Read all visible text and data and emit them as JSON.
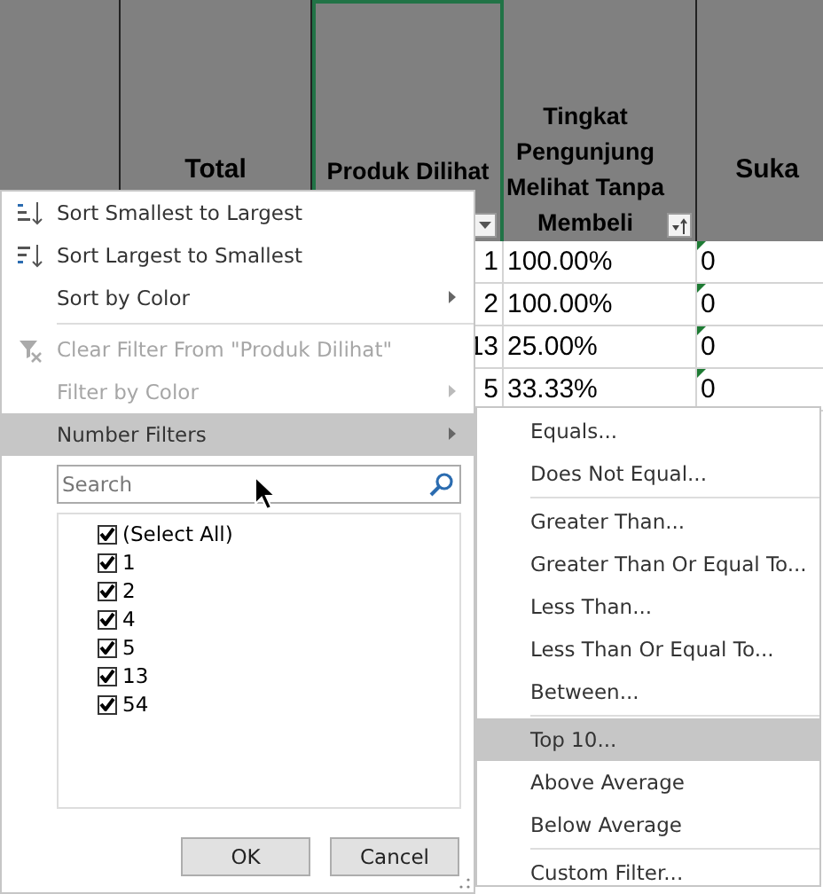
{
  "sheet": {
    "columns": [
      {
        "header": "Total",
        "selected": false,
        "kind": "plain"
      },
      {
        "header": "Produk Dilihat",
        "selected": true,
        "kind": "filter"
      },
      {
        "header": "Tingkat Pengunjung Melihat Tanpa Membeli",
        "selected": false,
        "kind": "sorted"
      },
      {
        "header": "Suka",
        "selected": false,
        "kind": "plain"
      }
    ],
    "rows": [
      {
        "cells": [
          "",
          "1",
          "100.00%",
          "0"
        ],
        "flagged": true
      },
      {
        "cells": [
          "",
          "2",
          "100.00%",
          "0"
        ],
        "flagged": true
      },
      {
        "cells": [
          "",
          "13",
          "25.00%",
          "0"
        ],
        "flagged": true
      },
      {
        "cells": [
          "",
          "5",
          "33.33%",
          "0"
        ],
        "flagged": true
      }
    ]
  },
  "filter_menu": {
    "items": [
      {
        "kind": "command",
        "label": "Sort Smallest to Largest",
        "disabled": false,
        "submenu": false,
        "selected": false
      },
      {
        "kind": "command",
        "label": "Sort Largest to Smallest",
        "disabled": false,
        "submenu": false,
        "selected": false
      },
      {
        "kind": "command",
        "label": "Sort by Color",
        "disabled": false,
        "submenu": true,
        "selected": false
      },
      {
        "kind": "separator"
      },
      {
        "kind": "command",
        "label": "Clear Filter From \"Produk Dilihat\"",
        "disabled": true,
        "submenu": false,
        "selected": false
      },
      {
        "kind": "command",
        "label": "Filter by Color",
        "disabled": true,
        "submenu": true,
        "selected": false
      },
      {
        "kind": "command",
        "label": "Number Filters",
        "disabled": false,
        "submenu": true,
        "selected": true
      }
    ],
    "search": {
      "placeholder": "Search"
    },
    "values": [
      {
        "label": "(Select All)",
        "checked": true
      },
      {
        "label": "1",
        "checked": true
      },
      {
        "label": "2",
        "checked": true
      },
      {
        "label": "4",
        "checked": true
      },
      {
        "label": "5",
        "checked": true
      },
      {
        "label": "13",
        "checked": true
      },
      {
        "label": "54",
        "checked": true
      }
    ],
    "buttons": [
      "OK",
      "Cancel"
    ]
  },
  "number_filters_menu": {
    "items": [
      {
        "kind": "command",
        "label": "Equals...",
        "selected": false
      },
      {
        "kind": "command",
        "label": "Does Not Equal...",
        "selected": false
      },
      {
        "kind": "separator"
      },
      {
        "kind": "command",
        "label": "Greater Than...",
        "selected": false
      },
      {
        "kind": "command",
        "label": "Greater Than Or Equal To...",
        "selected": false
      },
      {
        "kind": "command",
        "label": "Less Than...",
        "selected": false
      },
      {
        "kind": "command",
        "label": "Less Than Or Equal To...",
        "selected": false
      },
      {
        "kind": "command",
        "label": "Between...",
        "selected": false
      },
      {
        "kind": "separator"
      },
      {
        "kind": "command",
        "label": "Top 10...",
        "selected": true
      },
      {
        "kind": "command",
        "label": "Above Average",
        "selected": false
      },
      {
        "kind": "command",
        "label": "Below Average",
        "selected": false
      },
      {
        "kind": "separator"
      },
      {
        "kind": "command",
        "label": "Custom Filter...",
        "selected": false
      }
    ]
  }
}
